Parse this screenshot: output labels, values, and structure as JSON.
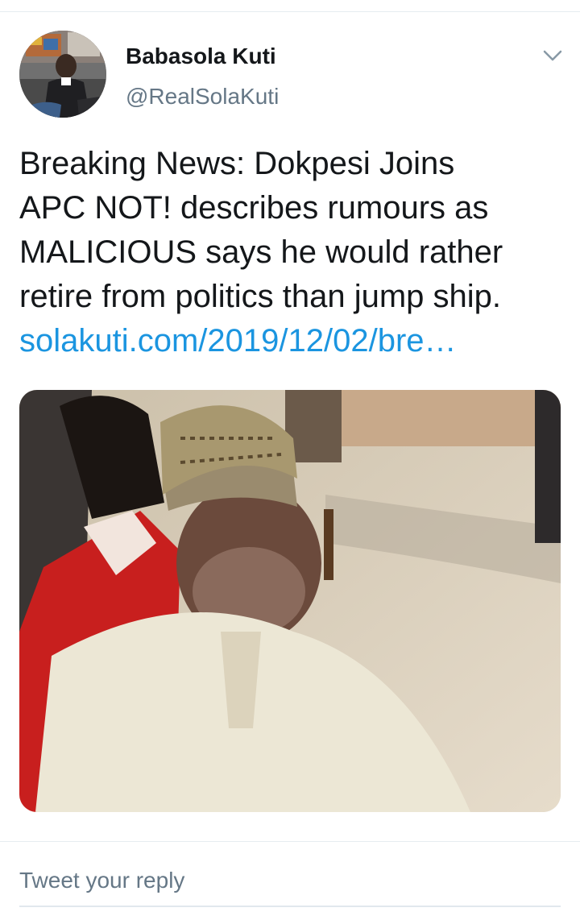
{
  "tweet": {
    "author": {
      "name": "Babasola Kuti",
      "handle": "@RealSolaKuti"
    },
    "text_lines": [
      "Breaking News: Dokpesi Joins",
      "APC NOT! describes rumours as",
      "MALICIOUS says he would rather",
      "retire from politics than jump ship."
    ],
    "link": "solakuti.com/2019/12/02/bre…"
  },
  "reply": {
    "placeholder": "Tweet your reply"
  },
  "icons": {
    "menu": "chevron-down-icon"
  },
  "colors": {
    "link": "#1b95e0",
    "secondary_text": "#657786",
    "divider": "#e6ecf0"
  }
}
